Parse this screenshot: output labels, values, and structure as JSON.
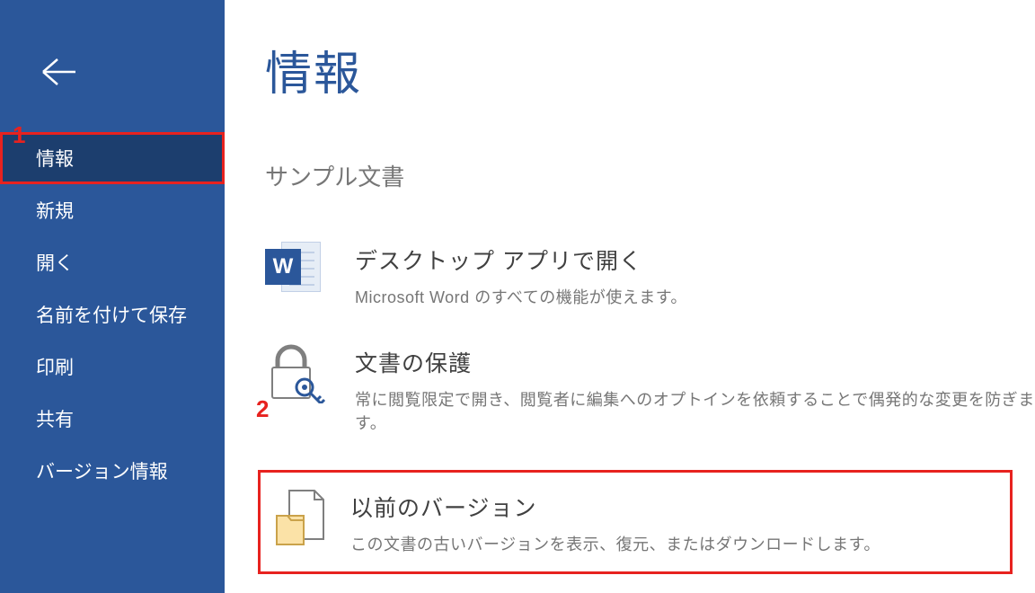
{
  "annotations": {
    "one": "1",
    "two": "2"
  },
  "sidebar": {
    "items": [
      {
        "label": "情報",
        "selected": true
      },
      {
        "label": "新規",
        "selected": false
      },
      {
        "label": "開く",
        "selected": false
      },
      {
        "label": "名前を付けて保存",
        "selected": false
      },
      {
        "label": "印刷",
        "selected": false
      },
      {
        "label": "共有",
        "selected": false
      },
      {
        "label": "バージョン情報",
        "selected": false
      }
    ]
  },
  "main": {
    "title": "情報",
    "doc_title": "サンプル文書",
    "sections": [
      {
        "heading": "デスクトップ アプリで開く",
        "desc": "Microsoft Word のすべての機能が使えます。"
      },
      {
        "heading": "文書の保護",
        "desc": "常に閲覧限定で開き、閲覧者に編集へのオプトインを依頼することで偶発的な変更を防ぎます。"
      },
      {
        "heading": "以前のバージョン",
        "desc": "この文書の古いバージョンを表示、復元、またはダウンロードします。"
      }
    ]
  }
}
